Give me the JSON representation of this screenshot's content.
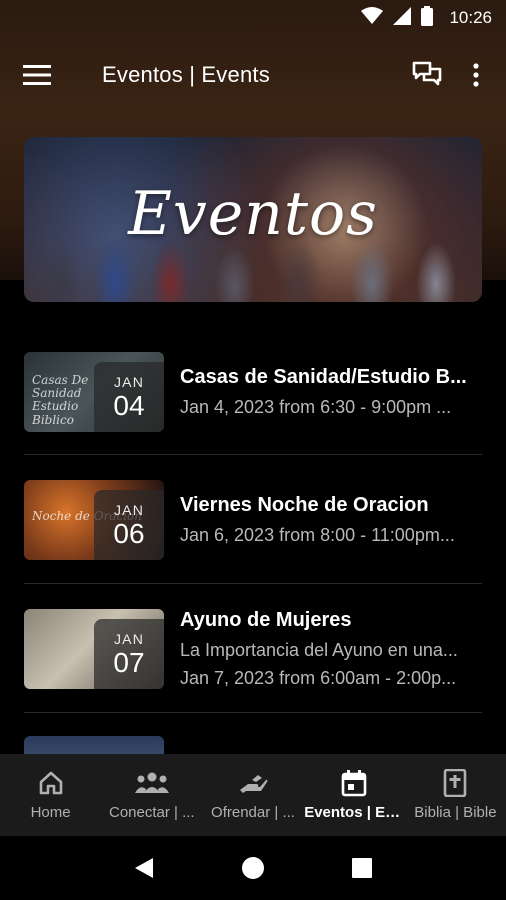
{
  "status_bar": {
    "time": "10:26",
    "icons": [
      "wifi-icon",
      "signal-icon",
      "battery-icon"
    ]
  },
  "app_bar": {
    "title": "Eventos | Events",
    "left_icon": "hamburger-menu-icon",
    "right_icons": [
      "chat-icon",
      "more-vert-icon"
    ]
  },
  "banner": {
    "title": "Eventos"
  },
  "events": [
    {
      "thumb_caption": "Casas De Sanidad Estudio Biblico",
      "month": "JAN",
      "day": "04",
      "title": "Casas de Sanidad/Estudio B...",
      "line1": "Jan 4, 2023 from 6:30 - 9:00pm ...",
      "line2": ""
    },
    {
      "thumb_caption": "Noche de Oracion",
      "month": "JAN",
      "day": "06",
      "title": "Viernes Noche de Oracion",
      "line1": "Jan 6, 2023 from 8:00 - 11:00pm...",
      "line2": ""
    },
    {
      "thumb_caption": "",
      "month": "JAN",
      "day": "07",
      "title": "Ayuno de Mujeres",
      "line1": "La Importancia del Ayuno en una...",
      "line2": "Jan 7, 2023 from 6:00am - 2:00p..."
    }
  ],
  "bottom_nav": {
    "items": [
      {
        "label": "Home",
        "icon": "home-icon",
        "active": false
      },
      {
        "label": "Conectar | ...",
        "icon": "people-icon",
        "active": false
      },
      {
        "label": "Ofrendar | ...",
        "icon": "giving-hand-icon",
        "active": false
      },
      {
        "label": "Eventos | Ev...",
        "icon": "calendar-icon",
        "active": true
      },
      {
        "label": "Biblia | Bible",
        "icon": "bible-icon",
        "active": false
      }
    ]
  },
  "system_nav": [
    "back-icon",
    "home-circle-icon",
    "recents-icon"
  ]
}
